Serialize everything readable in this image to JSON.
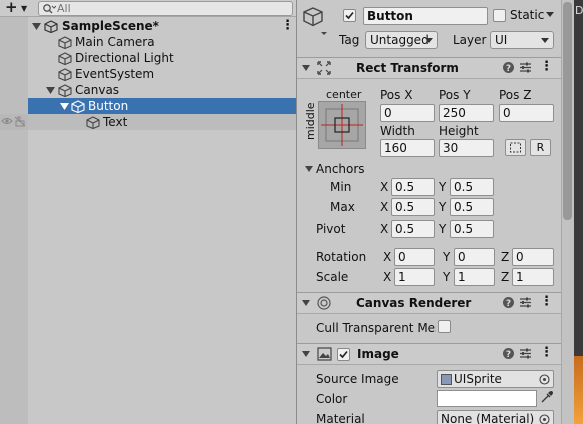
{
  "hierarchy": {
    "add_label": "+",
    "search_placeholder": "All",
    "scene": "SampleScene*",
    "items": [
      {
        "label": "Main Camera"
      },
      {
        "label": "Directional Light"
      },
      {
        "label": "EventSystem"
      },
      {
        "label": "Canvas"
      },
      {
        "label": "Button"
      },
      {
        "label": "Text"
      }
    ]
  },
  "inspector": {
    "object_name": "Button",
    "static_label": "Static",
    "tag_label": "Tag",
    "tag_value": "Untagged",
    "layer_label": "Layer",
    "layer_value": "UI",
    "rect_transform": {
      "title": "Rect Transform",
      "anchor_h": "center",
      "anchor_v": "middle",
      "posx_label": "Pos X",
      "posx": "0",
      "posy_label": "Pos Y",
      "posy": "250",
      "posz_label": "Pos Z",
      "posz": "0",
      "width_label": "Width",
      "width": "160",
      "height_label": "Height",
      "height": "30",
      "raw_btn": "R",
      "anchors_label": "Anchors",
      "min_label": "Min",
      "min_x": "0.5",
      "min_y": "0.5",
      "max_label": "Max",
      "max_x": "0.5",
      "max_y": "0.5",
      "pivot_label": "Pivot",
      "pivot_x": "0.5",
      "pivot_y": "0.5",
      "rotation_label": "Rotation",
      "rot_x": "0",
      "rot_y": "0",
      "rot_z": "0",
      "scale_label": "Scale",
      "scale_x": "1",
      "scale_y": "1",
      "scale_z": "1",
      "x": "X",
      "y": "Y",
      "z": "Z"
    },
    "canvas_renderer": {
      "title": "Canvas Renderer",
      "cull_label": "Cull Transparent Mes"
    },
    "image": {
      "title": "Image",
      "source_label": "Source Image",
      "source_value": "UISprite",
      "color_label": "Color",
      "material_label": "Material",
      "material_value": "None (Material)"
    }
  },
  "edge": {
    "letter": "D"
  },
  "colors": {
    "selection": "#3a72b0",
    "panel": "#c8c8c8",
    "field": "#f0f0f0"
  }
}
